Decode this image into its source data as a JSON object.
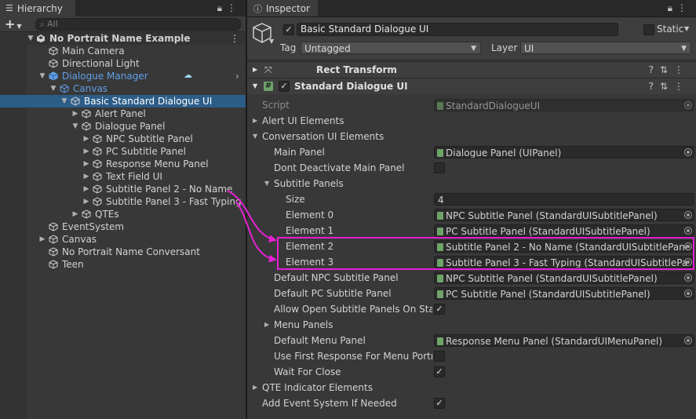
{
  "hierarchy": {
    "tab_label": "Hierarchy",
    "add_label": "+",
    "search_placeholder": "All",
    "rows": [
      {
        "label": "No Portrait Name Example",
        "depth": 0,
        "arrow": "down",
        "icon": "unity-scene",
        "scene": true
      },
      {
        "label": "Main Camera",
        "depth": 1
      },
      {
        "label": "Directional Light",
        "depth": 1
      },
      {
        "label": "Dialogue Manager",
        "depth": 1,
        "arrow": "down",
        "blue": true,
        "prefab": true
      },
      {
        "label": "Canvas",
        "depth": 2,
        "arrow": "down",
        "blue": true
      },
      {
        "label": "Basic Standard Dialogue UI",
        "depth": 3,
        "arrow": "down",
        "selected": true
      },
      {
        "label": "Alert Panel",
        "depth": 4,
        "arrow": "right"
      },
      {
        "label": "Dialogue Panel",
        "depth": 4,
        "arrow": "down"
      },
      {
        "label": "NPC Subtitle Panel",
        "depth": 5,
        "arrow": "right"
      },
      {
        "label": "PC Subtitle Panel",
        "depth": 5,
        "arrow": "right"
      },
      {
        "label": "Response Menu Panel",
        "depth": 5,
        "arrow": "right"
      },
      {
        "label": "Text Field UI",
        "depth": 5,
        "arrow": "right"
      },
      {
        "label": "Subtitle Panel 2 - No Name",
        "depth": 5,
        "arrow": "right"
      },
      {
        "label": "Subtitle Panel 3 - Fast Typing",
        "depth": 5,
        "arrow": "right"
      },
      {
        "label": "QTEs",
        "depth": 4,
        "arrow": "right"
      },
      {
        "label": "EventSystem",
        "depth": 1
      },
      {
        "label": "Canvas",
        "depth": 1,
        "arrow": "right"
      },
      {
        "label": "No Portrait Name Conversant",
        "depth": 1
      },
      {
        "label": "Teen",
        "depth": 1
      }
    ]
  },
  "inspector": {
    "tab_label": "Inspector",
    "object_name": "Basic Standard Dialogue UI",
    "static_label": "Static",
    "tag_label": "Tag",
    "tag_value": "Untagged",
    "layer_label": "Layer",
    "layer_value": "UI",
    "rect_transform_label": "Rect Transform",
    "component_label": "Standard Dialogue UI",
    "script_label": "Script",
    "script_value": "StandardDialogueUI",
    "rows": [
      {
        "label": "Alert UI Elements",
        "indent": 0,
        "foldout": "right"
      },
      {
        "label": "Conversation UI Elements",
        "indent": 0,
        "foldout": "down"
      },
      {
        "label": "Main Panel",
        "indent": 1,
        "object": "Dialogue Panel (UIPanel)"
      },
      {
        "label": "Dont Deactivate Main Panel",
        "indent": 1,
        "toggle": false
      },
      {
        "label": "Subtitle Panels",
        "indent": 1,
        "foldout": "down"
      },
      {
        "label": "Size",
        "indent": 2,
        "text": "4"
      },
      {
        "label": "Element 0",
        "indent": 2,
        "object": "NPC Subtitle Panel (StandardUISubtitlePanel)"
      },
      {
        "label": "Element 1",
        "indent": 2,
        "object": "PC Subtitle Panel (StandardUISubtitlePanel)"
      },
      {
        "label": "Element 2",
        "indent": 2,
        "object": "Subtitle Panel 2 - No Name (StandardUISubtitlePane"
      },
      {
        "label": "Element 3",
        "indent": 2,
        "object": "Subtitle Panel 3 - Fast Typing (StandardUISubtitlePa"
      },
      {
        "label": "Default NPC Subtitle Panel",
        "indent": 1,
        "object": "NPC Subtitle Panel (StandardUISubtitlePanel)"
      },
      {
        "label": "Default PC Subtitle Panel",
        "indent": 1,
        "object": "PC Subtitle Panel (StandardUISubtitlePanel)"
      },
      {
        "label": "Allow Open Subtitle Panels On Start",
        "indent": 1,
        "toggle": true
      },
      {
        "label": "Menu Panels",
        "indent": 1,
        "foldout": "right"
      },
      {
        "label": "Default Menu Panel",
        "indent": 1,
        "object": "Response Menu Panel (StandardUIMenuPanel)"
      },
      {
        "label": "Use First Response For Menu Portrai",
        "indent": 1,
        "toggle": false
      },
      {
        "label": "Wait For Close",
        "indent": 1,
        "toggle": true
      },
      {
        "label": "QTE Indicator Elements",
        "indent": 0,
        "foldout": "right"
      },
      {
        "label": "Add Event System If Needed",
        "indent": 0,
        "toggle": true
      }
    ]
  },
  "colors": {
    "highlight": "#e620d4",
    "selection": "#2c5d87",
    "prefab_blue": "#5f9fe7"
  }
}
